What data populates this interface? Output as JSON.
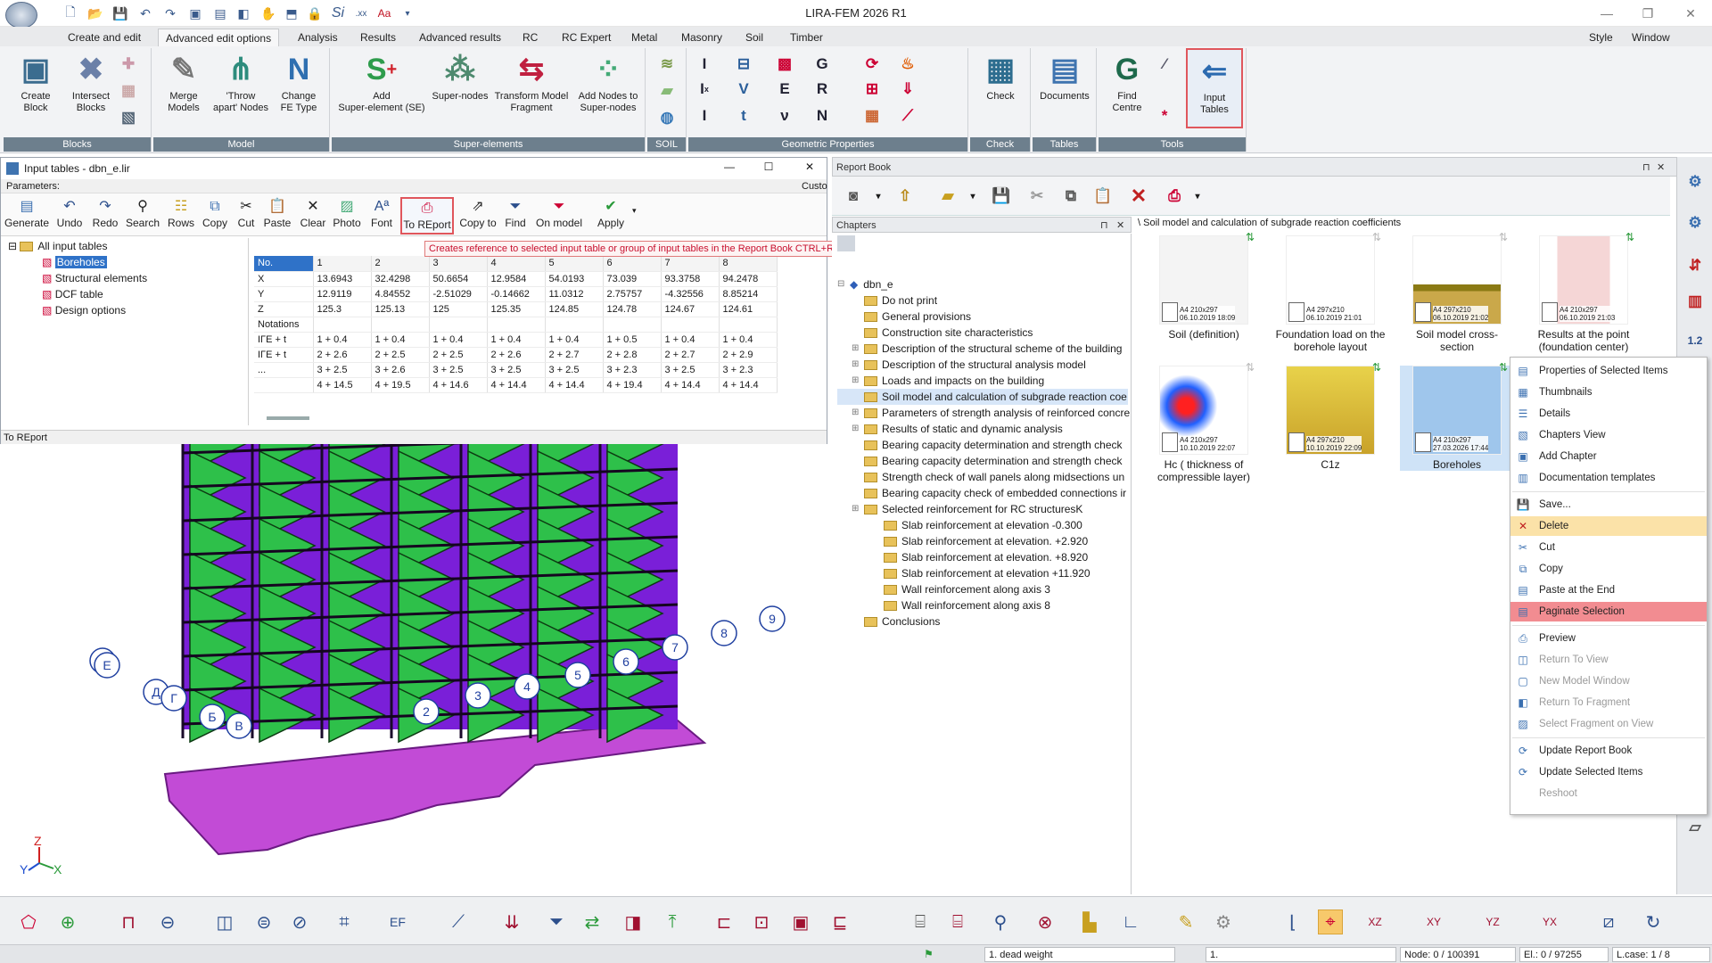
{
  "app_title": "LIRA-FEM 2026 R1",
  "window_controls": {
    "style": "Style",
    "window": "Window"
  },
  "tabs": [
    "Create and edit",
    "Advanced edit options",
    "Analysis",
    "Results",
    "Advanced results",
    "RC",
    "RC Expert",
    "Metal",
    "Masonry",
    "Soil",
    "Timber"
  ],
  "ribbon": {
    "blocks": {
      "label": "Blocks",
      "create": "Create\nBlock",
      "intersect": "Intersect\nBlocks"
    },
    "model": {
      "label": "Model",
      "merge": "Merge\nModels",
      "throw": "'Throw\napart' Nodes",
      "change": "Change\nFE Type"
    },
    "super": {
      "label": "Super-elements",
      "add": "Add\nSuper-element (SE)",
      "nodes": "Super-nodes",
      "transform": "Transform Model\nFragment",
      "addnodes": "Add Nodes to\nSuper-nodes"
    },
    "soil": {
      "label": "SOIL"
    },
    "geom": {
      "label": "Geometric Properties",
      "I": "I",
      "G": "G",
      "E": "E",
      "R": "R",
      "v": "ν",
      "N": "N",
      "t": "t"
    },
    "check": {
      "label": "Check",
      "btn": "Check"
    },
    "tables": {
      "label": "Tables",
      "btn": "Documents"
    },
    "tools": {
      "label": "Tools",
      "find": "Find\nCentre",
      "input": "Input\nTables"
    }
  },
  "input_tables": {
    "title": "Input tables - dbn_e.lir",
    "params": "Parameters:",
    "custom": "Custo",
    "toolbar": [
      "Generate",
      "Undo",
      "Redo",
      "Search",
      "Rows",
      "Copy",
      "Cut",
      "Paste",
      "Clear",
      "Photo",
      "Font",
      "To REport",
      "Copy to",
      "Find",
      "On model",
      "Apply"
    ],
    "tree": {
      "root": "All input tables",
      "items": [
        "Boreholes",
        "Structural elements",
        "DCF table",
        "Design options"
      ]
    },
    "grid": {
      "header": [
        "No.",
        "1",
        "2",
        "3",
        "4",
        "5",
        "6",
        "7",
        "8"
      ],
      "rows": [
        [
          "X",
          "13.6943",
          "32.4298",
          "50.6654",
          "12.9584",
          "54.0193",
          "73.039",
          "93.3758",
          "94.2478"
        ],
        [
          "Y",
          "12.9119",
          "4.84552",
          "-2.51029",
          "-0.14662",
          "11.0312",
          "2.75757",
          "-4.32556",
          "8.85214"
        ],
        [
          "Z",
          "125.3",
          "125.13",
          "125",
          "125.35",
          "124.85",
          "124.78",
          "124.67",
          "124.61"
        ],
        [
          "Notations",
          "",
          "",
          "",
          "",
          "",
          "",
          "",
          ""
        ],
        [
          "IΓE + t",
          "1 + 0.4",
          "1 + 0.4",
          "1 + 0.4",
          "1 + 0.4",
          "1 + 0.4",
          "1 + 0.5",
          "1 + 0.4",
          "1 + 0.4"
        ],
        [
          "IΓE + t",
          "2 + 2.6",
          "2 + 2.5",
          "2 + 2.5",
          "2 + 2.6",
          "2 + 2.7",
          "2 + 2.8",
          "2 + 2.7",
          "2 + 2.9"
        ],
        [
          "...",
          "3 + 2.5",
          "3 + 2.6",
          "3 + 2.5",
          "3 + 2.5",
          "3 + 2.5",
          "3 + 2.3",
          "3 + 2.5",
          "3 + 2.3"
        ],
        [
          "",
          "4 + 14.5",
          "4 + 19.5",
          "4 + 14.6",
          "4 + 14.4",
          "4 + 14.4",
          "4 + 19.4",
          "4 + 14.4",
          "4 + 14.4"
        ]
      ]
    },
    "tooltip": "Creates reference to selected input table or group of input tables in the Report Book CTRL+R",
    "status": "To REport"
  },
  "report_book": {
    "title": "Report Book",
    "chapters_title": "Chapters",
    "root": "dbn_e",
    "chapters": [
      "Do not print",
      "General provisions",
      "Construction site characteristics",
      "Description of the structural scheme of the building",
      "Description of the structural analysis model",
      "Loads and impacts on the building",
      "Soil model and calculation of subgrade reaction coe",
      "Parameters of strength analysis of reinforced concre",
      "Results of static and dynamic analysis",
      "Bearing capacity determination and strength check",
      "Bearing capacity determination and strength check",
      "Strength check of wall panels along midsections un",
      "Bearing capacity check of embedded connections ir",
      "Selected reinforcement for RC structuresK"
    ],
    "subchapters": [
      "Slab reinforcement at elevation -0.300",
      "Slab reinforcement at elevation. +2.920",
      "Slab reinforcement at elevation. +8.920",
      "Slab reinforcement at elevation +11.920",
      "Wall reinforcement along axis 3",
      "Wall reinforcement along axis 8"
    ],
    "last": "Conclusions",
    "path": "\\ Soil model and calculation of subgrade reaction coefficients",
    "thumbs": [
      {
        "name": "Soil (definition)",
        "size": "A4 210x297",
        "date": "06.10.2019 18:09"
      },
      {
        "name": "Foundation load on the borehole layout",
        "size": "A4 297x210",
        "date": "06.10.2019 21:01"
      },
      {
        "name": "Soil model cross-section",
        "size": "A4 297x210",
        "date": "06.10.2019 21:02"
      },
      {
        "name": "Results at the point (foundation center)",
        "size": "A4 210x297",
        "date": "06.10.2019 21:03"
      },
      {
        "name": "Hc ( thickness of compressible layer)",
        "size": "A4 210x297",
        "date": "10.10.2019 22:07"
      },
      {
        "name": "C1z",
        "size": "A4 297x210",
        "date": "10.10.2019 22:09"
      },
      {
        "name": "Boreholes",
        "size": "A4 210x297",
        "date": "27.03.2026 17:44"
      }
    ]
  },
  "context_menu": {
    "items": [
      "Properties of Selected Items",
      "Thumbnails",
      "Details",
      "Chapters View",
      "Add Chapter",
      "Documentation templates",
      "Save...",
      "Delete",
      "Cut",
      "Copy",
      "Paste at the End",
      "Paginate Selection",
      "Preview",
      "Return To View",
      "New Model Window",
      "Return To Fragment",
      "Select Fragment on View",
      "Update Report Book",
      "Update Selected Items",
      "Reshoot"
    ]
  },
  "viewport": {
    "axes": [
      "Ж",
      "Е",
      "Д",
      "Г",
      "Б",
      "В",
      "2",
      "3",
      "4",
      "5",
      "6",
      "7",
      "8",
      "9"
    ],
    "triad": {
      "x": "X",
      "y": "Y",
      "z": "Z"
    }
  },
  "statusbar": {
    "load": "1. dead weight",
    "field": "1.",
    "node": "Node: 0 / 100391",
    "el": "El.: 0 / 97255",
    "lcase": "L.case: 1 / 8"
  },
  "colors": {
    "accent": "#e0565c",
    "ribbon_label": "#6d7f8d",
    "wall_purple": "#7a1fd8",
    "slab_green": "#2ec04a",
    "plate_pink": "#c24bd6"
  }
}
